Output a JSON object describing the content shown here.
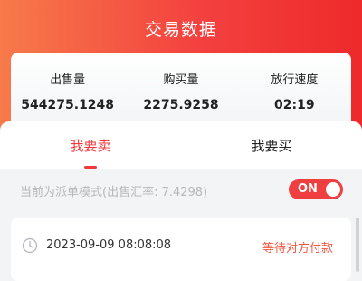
{
  "header": {
    "title": "交易数据"
  },
  "stats": [
    {
      "label": "出售量",
      "value": "544275.1248"
    },
    {
      "label": "购买量",
      "value": "2275.9258"
    },
    {
      "label": "放行速度",
      "value": "02:19"
    }
  ],
  "tabs": [
    {
      "label": "我要卖",
      "active": true
    },
    {
      "label": "我要买",
      "active": false
    }
  ],
  "mode": {
    "text": "当前为派单模式(出售汇率: 7.4298)",
    "toggle_label": "ON",
    "toggle_on": true
  },
  "order": {
    "icon": "clock-icon",
    "time": "2023-09-09 08:08:08",
    "status": "等待对方付款"
  },
  "colors": {
    "accent": "#f23a3a",
    "header_left": "#f77a4a",
    "header_right": "#ee2a2b",
    "status": "#f0563f"
  }
}
